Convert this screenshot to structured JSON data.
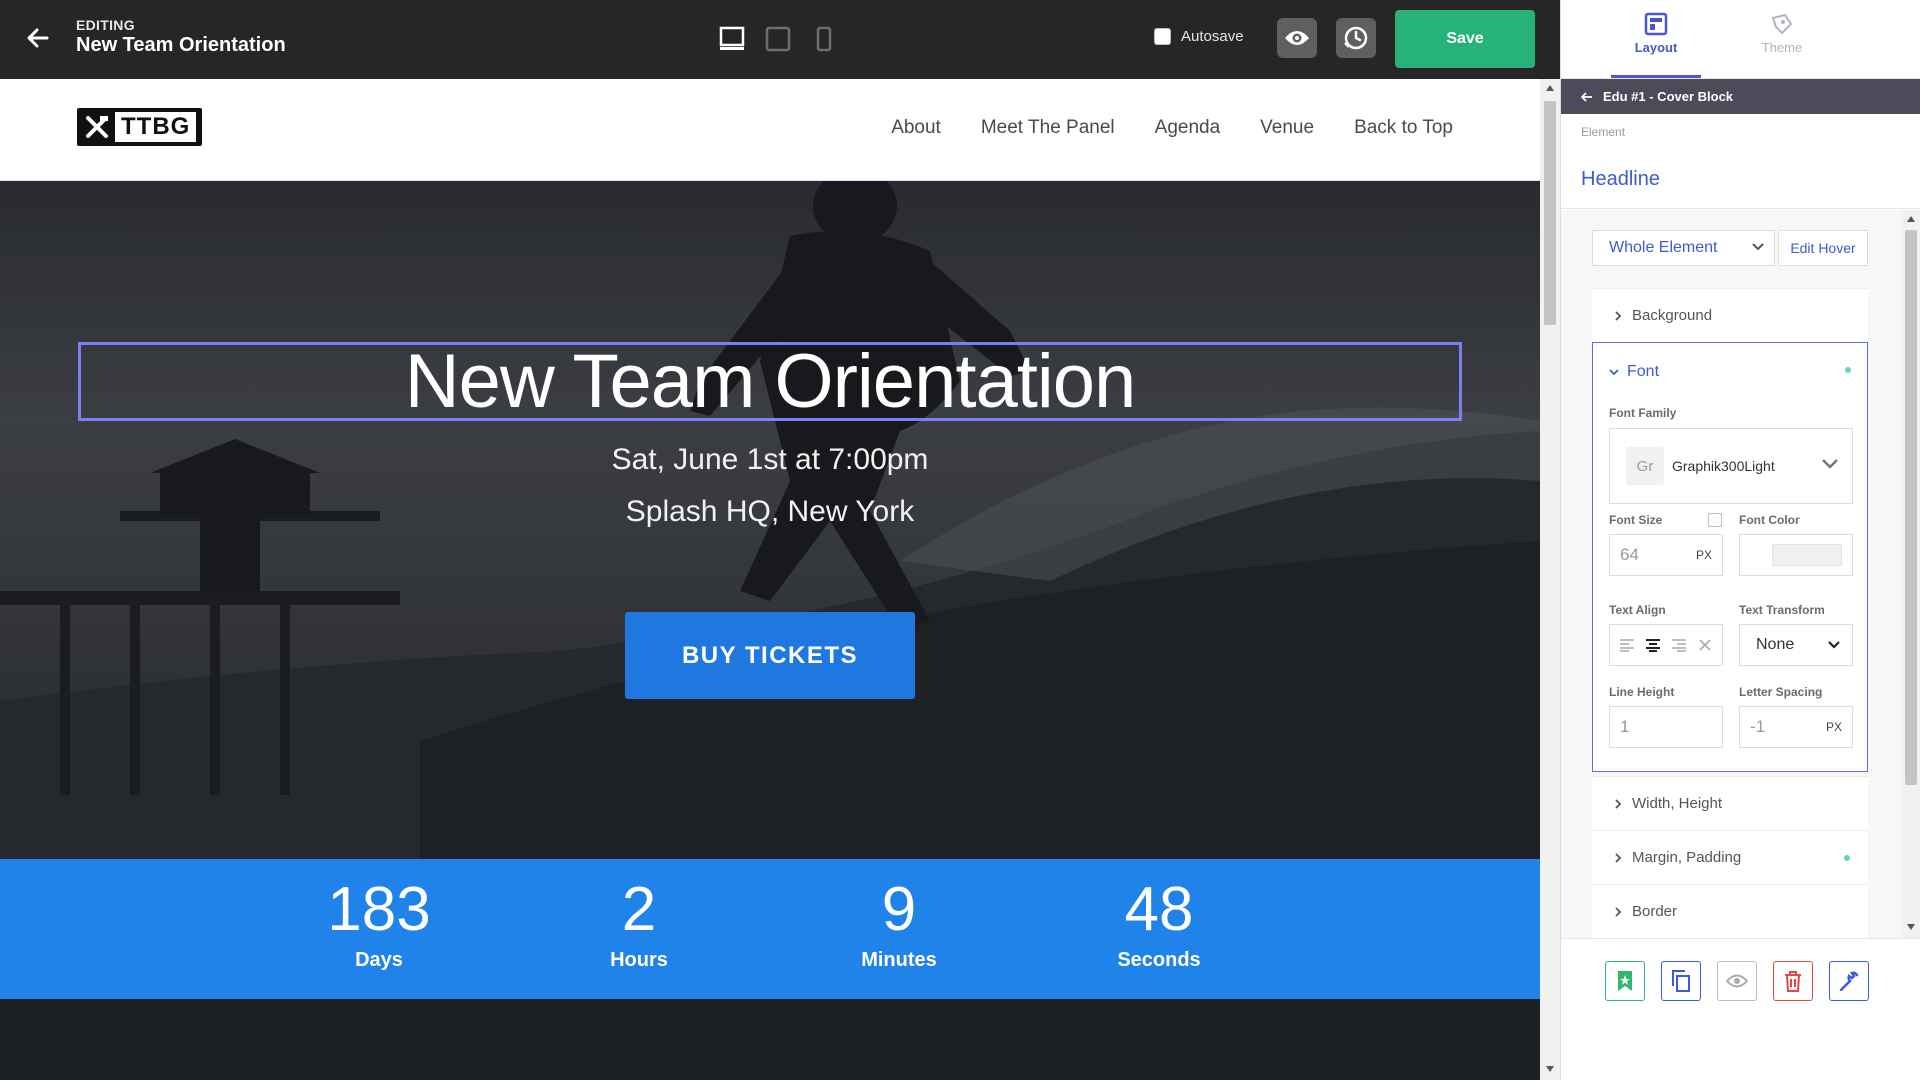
{
  "topbar": {
    "editing_label": "EDITING",
    "title": "New Team Orientation",
    "autosave_label": "Autosave",
    "save_label": "Save",
    "accent": "#27b27a"
  },
  "site": {
    "logo_text": "TTBG",
    "nav": [
      "About",
      "Meet The Panel",
      "Agenda",
      "Venue",
      "Back to Top"
    ]
  },
  "hero": {
    "headline": "New Team Orientation",
    "date_line": "Sat, June 1st at 7:00pm",
    "location_line": "Splash HQ, New York",
    "cta": "BUY TICKETS",
    "selection_color": "#7b7ff2"
  },
  "countdown": [
    {
      "value": "183",
      "label": "Days"
    },
    {
      "value": "2",
      "label": "Hours"
    },
    {
      "value": "9",
      "label": "Minutes"
    },
    {
      "value": "48",
      "label": "Seconds"
    }
  ],
  "panel": {
    "tabs": {
      "layout": "Layout",
      "theme": "Theme"
    },
    "breadcrumb": "Edu #1 - Cover Block",
    "element_label": "Element",
    "element_name": "Headline",
    "scope_select": "Whole Element",
    "edit_hover": "Edit Hover",
    "sections": {
      "background": "Background",
      "font": "Font",
      "width_height": "Width, Height",
      "margin_padding": "Margin, Padding",
      "border": "Border"
    },
    "font": {
      "family_label": "Font Family",
      "family_badge": "Gr",
      "family_value": "Graphik300Light",
      "size_label": "Font Size",
      "size_value": "64",
      "size_unit": "PX",
      "color_label": "Font Color",
      "align_label": "Text Align",
      "transform_label": "Text Transform",
      "transform_value": "None",
      "line_height_label": "Line Height",
      "line_height_value": "1",
      "letter_spacing_label": "Letter Spacing",
      "letter_spacing_value": "-1",
      "letter_spacing_unit": "PX"
    }
  }
}
